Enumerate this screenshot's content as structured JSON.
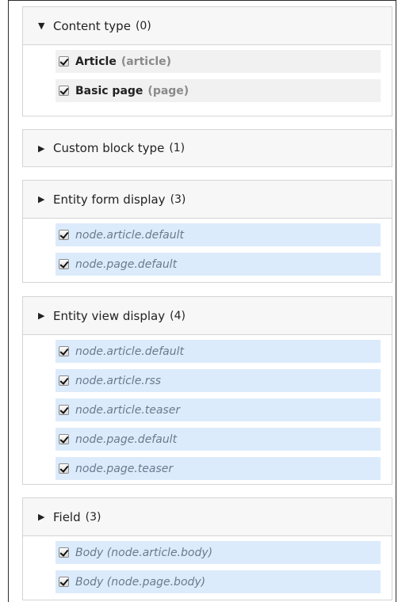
{
  "sections": [
    {
      "title": "Content type",
      "count": "(0)",
      "expanded": true,
      "items": [
        {
          "name": "Article",
          "machine": "(article)"
        },
        {
          "name": "Basic page",
          "machine": "(page)"
        }
      ]
    },
    {
      "title": "Custom block type",
      "count": "(1)",
      "expanded": false
    },
    {
      "title": "Entity form display",
      "count": "(3)",
      "expanded": true,
      "items": [
        {
          "label": "node.article.default"
        },
        {
          "label": "node.page.default"
        }
      ]
    },
    {
      "title": "Entity view display",
      "count": "(4)",
      "expanded": true,
      "items": [
        {
          "label": "node.article.default"
        },
        {
          "label": "node.article.rss"
        },
        {
          "label": "node.article.teaser"
        },
        {
          "label": "node.page.default"
        },
        {
          "label": "node.page.teaser"
        }
      ]
    },
    {
      "title": "Field",
      "count": "(3)",
      "expanded": true,
      "items": [
        {
          "label": "Body (node.article.body)"
        },
        {
          "label": "Body (node.page.body)"
        }
      ]
    }
  ],
  "icons": {
    "expanded": "triangle-down-icon",
    "collapsed": "triangle-right-icon",
    "checkbox": "checkbox-checked-icon"
  },
  "colors": {
    "highlight_blue": "#dcebfb",
    "highlight_gray": "#f1f1f1",
    "border": "#d4d4d4"
  }
}
